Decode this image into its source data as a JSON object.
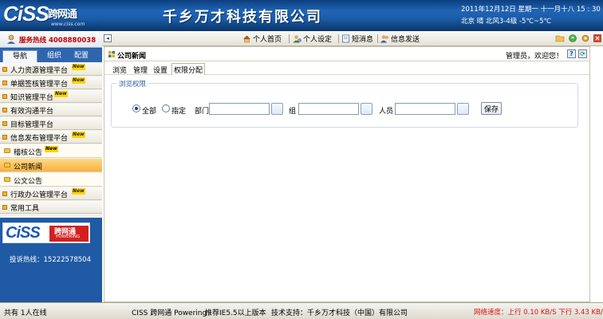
{
  "header": {
    "logo_word": "CiSS",
    "logo_cn": "跨网通",
    "logo_url": "www.ciss.com",
    "company_title": "千乡万才科技有限公司",
    "date_line": "2011年12月12日 星期一 十一月十八 15 : 30 :",
    "weather_line": "北京 晴 北风3-4级 -5℃~5℃"
  },
  "sidebar": {
    "hotline": "服务热线 4008880038",
    "tabs": {
      "nav": "导航",
      "group": "组织",
      "config": "配置"
    },
    "items": [
      {
        "label": "人力资源管理平台",
        "new": "New"
      },
      {
        "label": "单据签核管理平台",
        "new": "New"
      },
      {
        "label": "知识管理平台",
        "new": "New"
      },
      {
        "label": "有效沟通平台",
        "new": ""
      },
      {
        "label": "目标管理平台",
        "new": ""
      },
      {
        "label": "信息发布管理平台",
        "new": "New"
      },
      {
        "label": "稽核公告",
        "new": "New"
      },
      {
        "label": "公司新闻",
        "new": ""
      },
      {
        "label": "公文公告",
        "new": ""
      },
      {
        "label": "行政办公管理平台",
        "new": "New"
      },
      {
        "label": "常用工具",
        "new": ""
      }
    ],
    "brand_logo": {
      "word": "CiSS",
      "cn": "跨网通",
      "powering": "POWERING"
    },
    "complaint": "投诉热线：15222578504"
  },
  "toolbar": {
    "home": "个人首页",
    "settings": "个人设定",
    "sms": "短消息",
    "send": "信息发送"
  },
  "content": {
    "title": "公司新闻",
    "greeting": "管理员，欢迎您！",
    "tabs": [
      "浏览",
      "管理",
      "设置",
      "权限分配"
    ],
    "active_tab": "权限分配",
    "fieldset_legend": "浏览权限",
    "radio_all": "全部",
    "radio_specify": "指定",
    "dept_label": "部门",
    "group_label": "组",
    "person_label": "人员",
    "dept_value": "",
    "group_value": "",
    "person_value": "",
    "save": "保存"
  },
  "statusbar": {
    "online": "共有 1人在线",
    "brand": "CISS 跨网通 Powering",
    "ie": "推荐IE5.5以上版本",
    "support": "技术支持：千乡万才科技（中国）有限公司",
    "speed": "网络速度：上行 0.10 KB/S 下行 3.43 KB/S"
  },
  "colors": {
    "header_blue": "#1b5ca8",
    "sidebar_blue": "#205aa4",
    "hotline_red": "#c00000",
    "active_orange": "#f7b23b",
    "speed_red": "#dd1111"
  }
}
